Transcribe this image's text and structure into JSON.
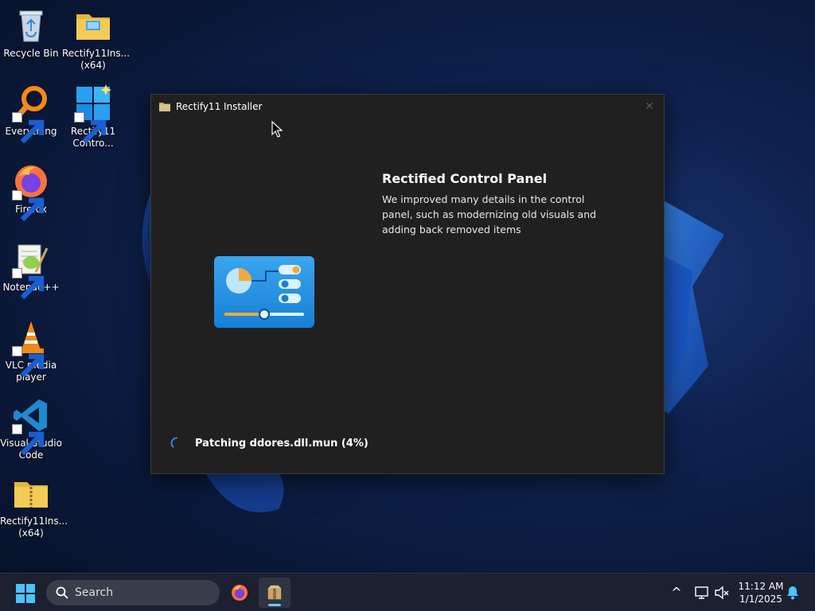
{
  "desktop": {
    "icons": [
      {
        "id": "recycle-bin",
        "label": "Recycle Bin"
      },
      {
        "id": "rectify-installer-top",
        "label": "Rectify11Ins... (x64)"
      },
      {
        "id": "everything",
        "label": "Everything"
      },
      {
        "id": "rectify-control",
        "label": "Rectify11 Contro..."
      },
      {
        "id": "firefox",
        "label": "Firefox"
      },
      {
        "id": "notepadpp",
        "label": "Notepad++"
      },
      {
        "id": "vlc",
        "label": "VLC media player"
      },
      {
        "id": "vscode",
        "label": "Visual Studio Code"
      },
      {
        "id": "rectify-installer-zip",
        "label": "Rectify11Ins... (x64)"
      }
    ]
  },
  "installer": {
    "title": "Rectify11 Installer",
    "close_label": "✕",
    "feature_title": "Rectified Control Panel",
    "feature_description": "We improved many details in the control panel, such as modernizing old visuals and adding back removed items",
    "status": "Patching ddores.dll.mun (4%)",
    "progress_percent": 4
  },
  "taskbar": {
    "search_label": "Search",
    "time": "11:12 AM",
    "date": "1/1/2025",
    "tray_chevron": "^"
  },
  "colors": {
    "accent": "#0078d4",
    "window_bg": "#202020",
    "taskbar_bg": "#1c2030",
    "indicator": "#6cc8ff"
  }
}
